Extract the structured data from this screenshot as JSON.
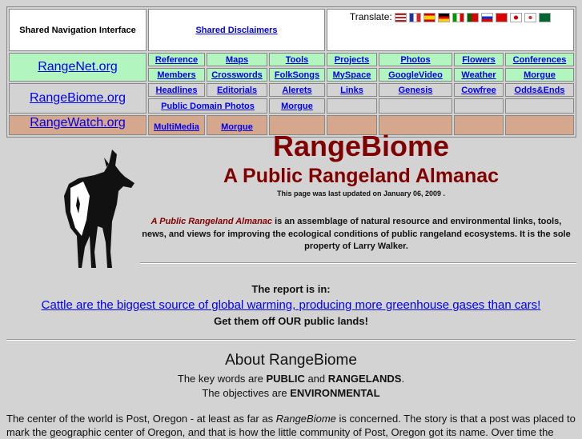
{
  "nav": {
    "shared_nav": "Shared Navigation Interface",
    "shared_disclaimers": "Shared Disclaimers",
    "translate_label": "Translate:",
    "flags": [
      "english",
      "french",
      "spanish",
      "german",
      "italian",
      "portuguese",
      "russian",
      "chinese",
      "japanese",
      "korean",
      "arabic"
    ],
    "rangenet": "RangeNet.org",
    "rangebiome": "RangeBiome.org",
    "rangewatch": "RangeWatch.org",
    "row1": [
      "Reference",
      "Maps",
      "Tools",
      "Projects",
      "Photos",
      "Flowers",
      "Conferences"
    ],
    "row2": [
      "Members",
      "Crosswords",
      "FolkSongs",
      "MySpace",
      "GoogleVideo",
      "Weather",
      "Morgue"
    ],
    "row3": [
      "Headlines",
      "Editorials",
      "Alerets",
      "Links",
      "Genesis",
      "Cowfree",
      "Odds&Ends"
    ],
    "row4": [
      "Public Domain Photos",
      "Morgue"
    ],
    "row5": [
      "MultiMedia",
      "Morgue"
    ]
  },
  "header": {
    "title": "RangeBiome",
    "subtitle": "A Public Rangeland Almanac",
    "updated": "This page was last updated on January 06, 2009 ."
  },
  "intro": {
    "em": "A Public Rangeland Almanac",
    "text": " is an assemblage of natural resource and environmental links, tools, news, and views for improving the ecological conditions of public rangeland ecosystems. It is the sole property of Larry Walker."
  },
  "report": {
    "lead": "The report is in:",
    "link": "Cattle are the biggest source of global warming, producing more greenhouse gases than cars!",
    "tail": "Get them off OUR public lands!"
  },
  "about": {
    "title": "About RangeBiome",
    "l1a": "The key words are ",
    "l1b": "PUBLIC",
    "l1c": " and ",
    "l1d": "RANGELANDS",
    "l1e": ".",
    "l2a": "The objectives are ",
    "l2b": "ENVIRONMENTAL"
  },
  "body": {
    "a": "The center of the world is Post, Oregon - at least as far as ",
    "em": "RangeBiome",
    "b": " is concerned. The story is that a post was placed to mark the geographic center of Oregon, and that is how the little community of Post, Oregon got its name. Over time the"
  }
}
